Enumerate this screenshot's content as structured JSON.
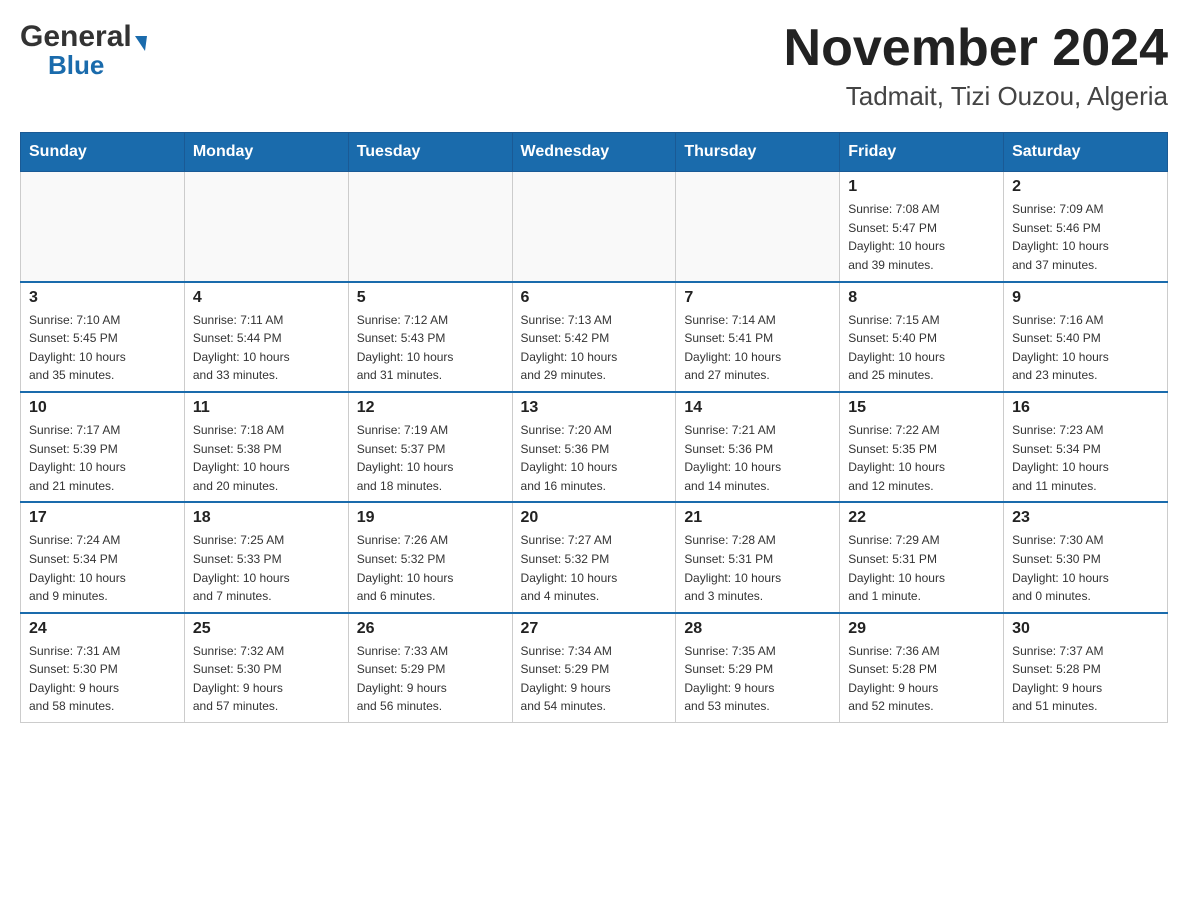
{
  "header": {
    "title": "November 2024",
    "subtitle": "Tadmait, Tizi Ouzou, Algeria",
    "logo_general": "General",
    "logo_blue": "Blue"
  },
  "weekdays": [
    "Sunday",
    "Monday",
    "Tuesday",
    "Wednesday",
    "Thursday",
    "Friday",
    "Saturday"
  ],
  "weeks": [
    {
      "days": [
        {
          "number": "",
          "info": ""
        },
        {
          "number": "",
          "info": ""
        },
        {
          "number": "",
          "info": ""
        },
        {
          "number": "",
          "info": ""
        },
        {
          "number": "",
          "info": ""
        },
        {
          "number": "1",
          "info": "Sunrise: 7:08 AM\nSunset: 5:47 PM\nDaylight: 10 hours\nand 39 minutes."
        },
        {
          "number": "2",
          "info": "Sunrise: 7:09 AM\nSunset: 5:46 PM\nDaylight: 10 hours\nand 37 minutes."
        }
      ]
    },
    {
      "days": [
        {
          "number": "3",
          "info": "Sunrise: 7:10 AM\nSunset: 5:45 PM\nDaylight: 10 hours\nand 35 minutes."
        },
        {
          "number": "4",
          "info": "Sunrise: 7:11 AM\nSunset: 5:44 PM\nDaylight: 10 hours\nand 33 minutes."
        },
        {
          "number": "5",
          "info": "Sunrise: 7:12 AM\nSunset: 5:43 PM\nDaylight: 10 hours\nand 31 minutes."
        },
        {
          "number": "6",
          "info": "Sunrise: 7:13 AM\nSunset: 5:42 PM\nDaylight: 10 hours\nand 29 minutes."
        },
        {
          "number": "7",
          "info": "Sunrise: 7:14 AM\nSunset: 5:41 PM\nDaylight: 10 hours\nand 27 minutes."
        },
        {
          "number": "8",
          "info": "Sunrise: 7:15 AM\nSunset: 5:40 PM\nDaylight: 10 hours\nand 25 minutes."
        },
        {
          "number": "9",
          "info": "Sunrise: 7:16 AM\nSunset: 5:40 PM\nDaylight: 10 hours\nand 23 minutes."
        }
      ]
    },
    {
      "days": [
        {
          "number": "10",
          "info": "Sunrise: 7:17 AM\nSunset: 5:39 PM\nDaylight: 10 hours\nand 21 minutes."
        },
        {
          "number": "11",
          "info": "Sunrise: 7:18 AM\nSunset: 5:38 PM\nDaylight: 10 hours\nand 20 minutes."
        },
        {
          "number": "12",
          "info": "Sunrise: 7:19 AM\nSunset: 5:37 PM\nDaylight: 10 hours\nand 18 minutes."
        },
        {
          "number": "13",
          "info": "Sunrise: 7:20 AM\nSunset: 5:36 PM\nDaylight: 10 hours\nand 16 minutes."
        },
        {
          "number": "14",
          "info": "Sunrise: 7:21 AM\nSunset: 5:36 PM\nDaylight: 10 hours\nand 14 minutes."
        },
        {
          "number": "15",
          "info": "Sunrise: 7:22 AM\nSunset: 5:35 PM\nDaylight: 10 hours\nand 12 minutes."
        },
        {
          "number": "16",
          "info": "Sunrise: 7:23 AM\nSunset: 5:34 PM\nDaylight: 10 hours\nand 11 minutes."
        }
      ]
    },
    {
      "days": [
        {
          "number": "17",
          "info": "Sunrise: 7:24 AM\nSunset: 5:34 PM\nDaylight: 10 hours\nand 9 minutes."
        },
        {
          "number": "18",
          "info": "Sunrise: 7:25 AM\nSunset: 5:33 PM\nDaylight: 10 hours\nand 7 minutes."
        },
        {
          "number": "19",
          "info": "Sunrise: 7:26 AM\nSunset: 5:32 PM\nDaylight: 10 hours\nand 6 minutes."
        },
        {
          "number": "20",
          "info": "Sunrise: 7:27 AM\nSunset: 5:32 PM\nDaylight: 10 hours\nand 4 minutes."
        },
        {
          "number": "21",
          "info": "Sunrise: 7:28 AM\nSunset: 5:31 PM\nDaylight: 10 hours\nand 3 minutes."
        },
        {
          "number": "22",
          "info": "Sunrise: 7:29 AM\nSunset: 5:31 PM\nDaylight: 10 hours\nand 1 minute."
        },
        {
          "number": "23",
          "info": "Sunrise: 7:30 AM\nSunset: 5:30 PM\nDaylight: 10 hours\nand 0 minutes."
        }
      ]
    },
    {
      "days": [
        {
          "number": "24",
          "info": "Sunrise: 7:31 AM\nSunset: 5:30 PM\nDaylight: 9 hours\nand 58 minutes."
        },
        {
          "number": "25",
          "info": "Sunrise: 7:32 AM\nSunset: 5:30 PM\nDaylight: 9 hours\nand 57 minutes."
        },
        {
          "number": "26",
          "info": "Sunrise: 7:33 AM\nSunset: 5:29 PM\nDaylight: 9 hours\nand 56 minutes."
        },
        {
          "number": "27",
          "info": "Sunrise: 7:34 AM\nSunset: 5:29 PM\nDaylight: 9 hours\nand 54 minutes."
        },
        {
          "number": "28",
          "info": "Sunrise: 7:35 AM\nSunset: 5:29 PM\nDaylight: 9 hours\nand 53 minutes."
        },
        {
          "number": "29",
          "info": "Sunrise: 7:36 AM\nSunset: 5:28 PM\nDaylight: 9 hours\nand 52 minutes."
        },
        {
          "number": "30",
          "info": "Sunrise: 7:37 AM\nSunset: 5:28 PM\nDaylight: 9 hours\nand 51 minutes."
        }
      ]
    }
  ]
}
